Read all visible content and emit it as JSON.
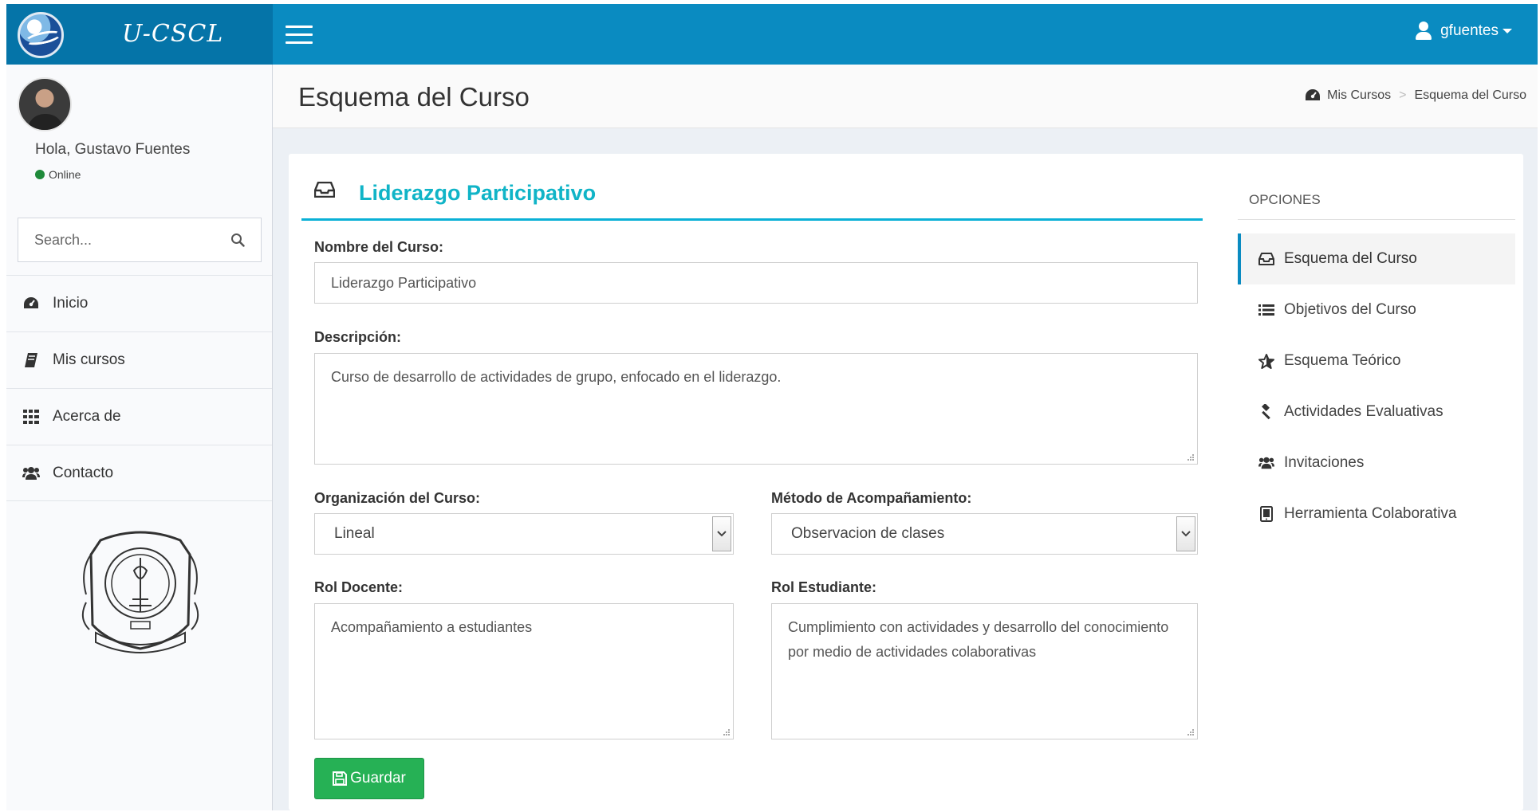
{
  "app": {
    "logo_text": "U-CSCL"
  },
  "header": {
    "username": "gfuentes"
  },
  "sidebar": {
    "greeting": "Hola, Gustavo Fuentes",
    "status": "Online",
    "search_placeholder": "Search...",
    "nav": [
      {
        "label": "Inicio",
        "icon": "dashboard-icon"
      },
      {
        "label": "Mis cursos",
        "icon": "book-icon"
      },
      {
        "label": "Acerca de",
        "icon": "grid-icon"
      },
      {
        "label": "Contacto",
        "icon": "users-icon"
      }
    ]
  },
  "page": {
    "title": "Esquema del Curso",
    "breadcrumb": [
      "Mis Cursos",
      "Esquema del Curso"
    ]
  },
  "form": {
    "panel_title": "Liderazgo Participativo",
    "course_name_label": "Nombre del Curso:",
    "course_name_value": "Liderazgo Participativo",
    "description_label": "Descripción:",
    "description_value": "Curso de desarrollo de actividades de grupo, enfocado en el liderazgo.",
    "organization_label": "Organización del Curso:",
    "organization_value": "Lineal",
    "method_label": "Método de Acompañamiento:",
    "method_value": "Observacion de clases",
    "teacher_role_label": "Rol Docente:",
    "teacher_role_value": "Acompañamiento a estudiantes",
    "student_role_label": "Rol Estudiante:",
    "student_role_value": "Cumplimiento con actividades y desarrollo del conocimiento por medio de actividades colaborativas",
    "save_label": "Guardar"
  },
  "options": {
    "title": "OPCIONES",
    "items": [
      {
        "label": "Esquema del Curso",
        "icon": "inbox-icon",
        "active": true
      },
      {
        "label": "Objetivos del Curso",
        "icon": "list-icon"
      },
      {
        "label": "Esquema Teórico",
        "icon": "star-icon"
      },
      {
        "label": "Actividades Evaluativas",
        "icon": "gavel-icon"
      },
      {
        "label": "Invitaciones",
        "icon": "users-icon"
      },
      {
        "label": "Herramienta Colaborativa",
        "icon": "tablet-icon"
      }
    ]
  },
  "colors": {
    "header": "#0a8bc1",
    "logo_bg": "#0574a8",
    "title_accent": "#10b4c7",
    "save_button": "#26b155"
  }
}
